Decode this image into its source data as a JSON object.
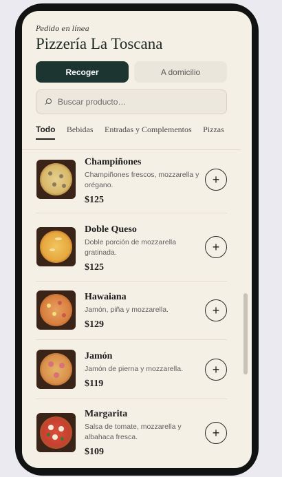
{
  "header": {
    "subtitle": "Pedido en línea",
    "title": "Pizzería La Toscana"
  },
  "mode": {
    "pickup_label": "Recoger",
    "delivery_label": "A domicilio",
    "selected": "pickup"
  },
  "search": {
    "placeholder": "Buscar producto…",
    "value": ""
  },
  "tabs": [
    {
      "label": "Todo",
      "active": true
    },
    {
      "label": "Bebidas",
      "active": false
    },
    {
      "label": "Entradas y Complementos",
      "active": false
    },
    {
      "label": "Pizzas",
      "active": false
    }
  ],
  "products": [
    {
      "name": "Champiñones",
      "description": "Champiñones frescos, mozzarella y orégano.",
      "price": "$125",
      "image_icon": "mushroom-pizza-image"
    },
    {
      "name": "Doble Queso",
      "description": "Doble porción de mozzarella gratinada.",
      "price": "$125",
      "image_icon": "double-cheese-pizza-image"
    },
    {
      "name": "Hawaiana",
      "description": "Jamón, piña y mozzarella.",
      "price": "$129",
      "image_icon": "hawaiian-pizza-image"
    },
    {
      "name": "Jamón",
      "description": "Jamón de pierna y mozzarella.",
      "price": "$119",
      "image_icon": "ham-pizza-image"
    },
    {
      "name": "Margarita",
      "description": "Salsa de tomate, mozzarella y albahaca fresca.",
      "price": "$109",
      "image_icon": "margherita-pizza-image"
    }
  ],
  "add_button_symbol": "+",
  "colors": {
    "accent": "#1c3530",
    "background": "#f5f0e6",
    "frame": "#111312"
  }
}
